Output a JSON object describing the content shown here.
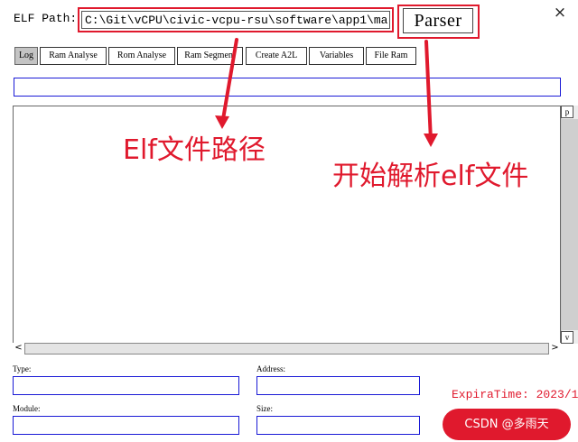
{
  "header": {
    "elf_path_label": "ELF Path:",
    "elf_path_value": "C:\\Git\\vCPU\\civic-vcpu-rsu\\software\\app1\\ma",
    "parser_label": "Parser",
    "close_symbol": "×"
  },
  "tabs": [
    {
      "label": "Log",
      "active": true
    },
    {
      "label": "Ram Analyse",
      "active": false
    },
    {
      "label": "Rom Analyse",
      "active": false
    },
    {
      "label": "Ram Segment",
      "active": false
    },
    {
      "label": "Create A2L",
      "active": false
    },
    {
      "label": "Variables",
      "active": false
    },
    {
      "label": "File Ram",
      "active": false
    }
  ],
  "log": {
    "scroll_up": "p",
    "scroll_down": "v",
    "scroll_left": "<",
    "scroll_right": ">"
  },
  "annotations": {
    "path_note": "Elf文件路径",
    "parser_note": "开始解析elf文件"
  },
  "fields": {
    "type_label": "Type:",
    "address_label": "Address:",
    "module_label": "Module:",
    "size_label": "Size:"
  },
  "footer": {
    "expira_text": "ExpiraTime: 2023/1",
    "watermark": "CSDN @多雨天"
  },
  "colors": {
    "annotation_red": "#e0192d",
    "field_border_blue": "#1a1ad6",
    "active_tab_gray": "#c4c4c4"
  }
}
